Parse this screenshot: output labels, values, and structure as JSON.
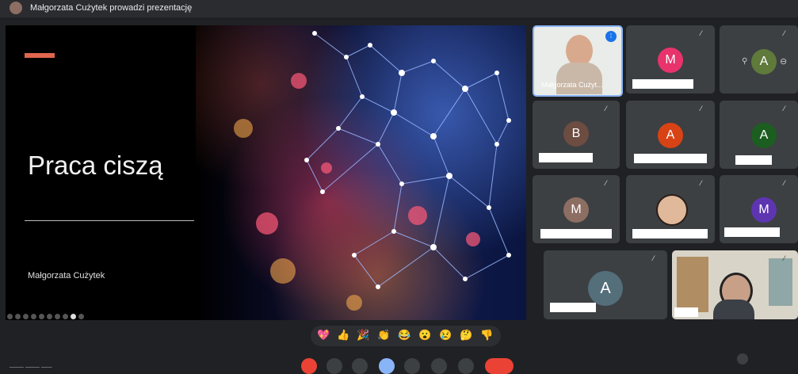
{
  "header": {
    "presenter_text": "Małgorzata Cużytek prowadzi prezentację",
    "avatar_icon": "user-avatar-icon"
  },
  "slide": {
    "title": "Praca ciszą",
    "author": "Małgorzata Cużytek",
    "accent_color": "#e0664d"
  },
  "participants": {
    "speaker_name": "Małgorzata Cużyt...",
    "tile_m1": "M",
    "tile_a1": "A",
    "tile_b": "B",
    "tile_a2": "A",
    "tile_a3": "A",
    "tile_m2": "M",
    "tile_m3": "M",
    "tile_a4": "A"
  },
  "reactions": [
    "💖",
    "👍",
    "🎉",
    "👏",
    "😂",
    "😮",
    "😢",
    "🤔",
    "👎"
  ],
  "bottom": {
    "meeting_code": "____ ____ ___"
  },
  "colors": {
    "m1": "#e8336d",
    "a1": "#5f7a3a",
    "b": "#6d4c41",
    "a2": "#d84315",
    "a3": "#1b5e20",
    "m2": "#8d6e63",
    "m3": "#5e35b1",
    "a4": "#546e7a",
    "end_call": "#ea4335",
    "active_speaker": "#8ab4f8"
  }
}
